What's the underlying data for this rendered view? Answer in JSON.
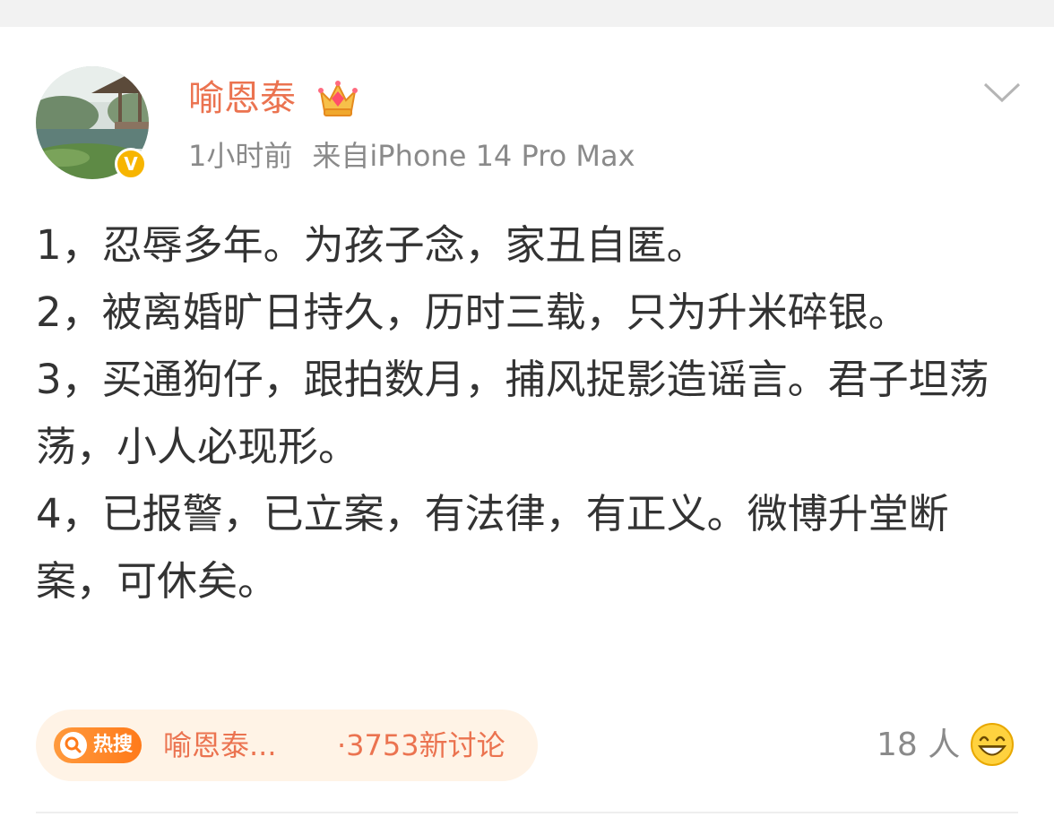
{
  "post": {
    "author": {
      "name": "喻恩泰",
      "verified_color": "#f7b500",
      "verified_label": "V",
      "crown_icon": "crown-icon"
    },
    "time": "1小时前",
    "source": "来自iPhone 14 Pro Max",
    "paragraphs": [
      "1，忍辱多年。为孩子念，家丑自匿。",
      "2，被离婚旷日持久，历时三载，只为升米碎银。",
      "3，买通狗仔，跟拍数月，捕风捉影造谣言。君子坦荡荡，小人必现形。",
      "4，已报警，已立案，有法律，有正义。微博升堂断案，可休矣。"
    ]
  },
  "hot_topic": {
    "badge_label": "热搜",
    "topic_name": "喻恩泰...",
    "discussion_count": "·3753新讨论"
  },
  "reactions": {
    "count_label": "18 人",
    "emoji_icon": "grin-emoji-icon"
  },
  "colors": {
    "accent_orange": "#eb7350",
    "meta_gray": "#8a8a8a",
    "body_text": "#333333",
    "hot_bar_bg": "#fff3e6"
  }
}
